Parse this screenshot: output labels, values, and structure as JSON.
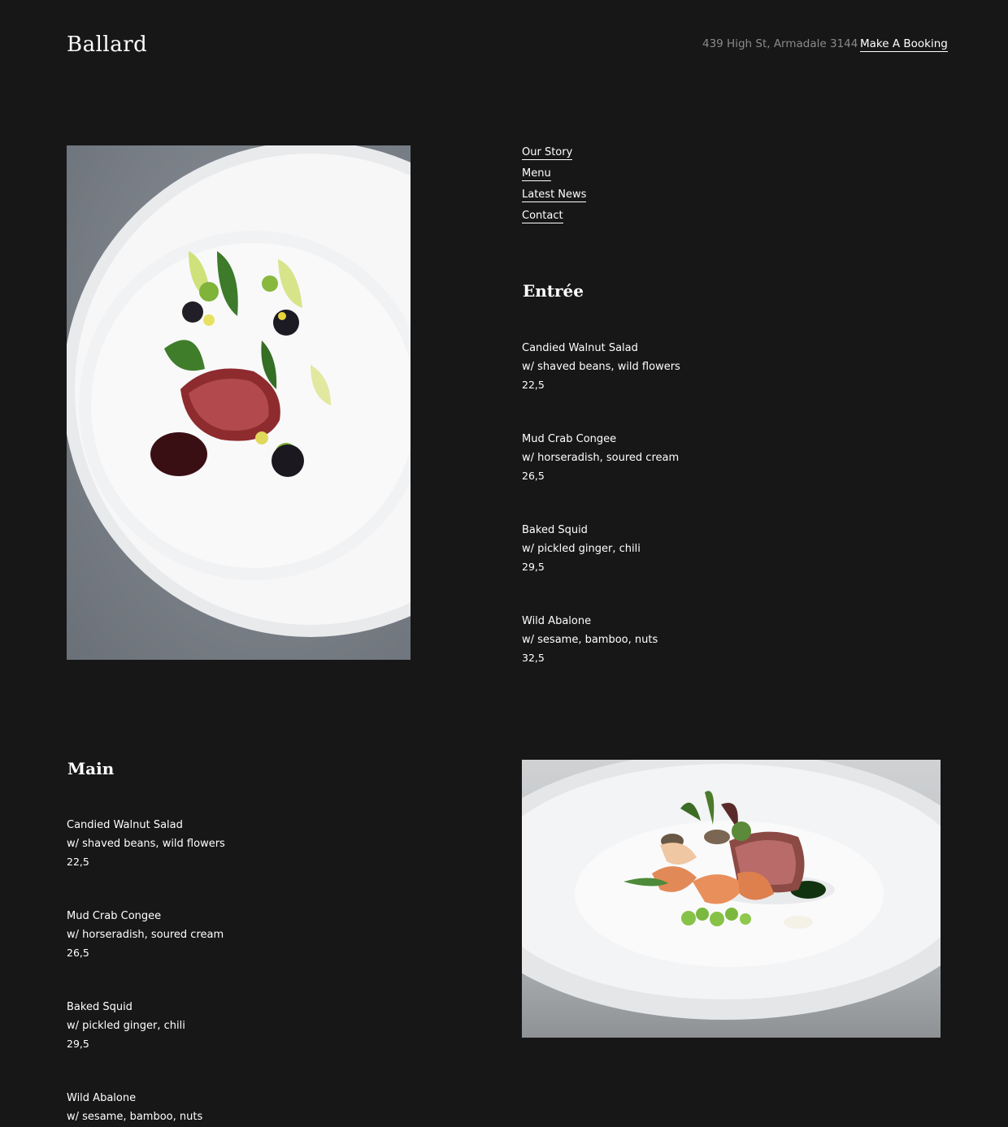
{
  "header": {
    "logo": "Ballard",
    "address": "439 High St, Armadale 3144",
    "booking_label": "Make A Booking"
  },
  "nav": {
    "items": [
      {
        "label": "Our Story"
      },
      {
        "label": "Menu"
      },
      {
        "label": "Latest News"
      },
      {
        "label": "Contact"
      }
    ]
  },
  "entree": {
    "title": "Entrée",
    "dishes": [
      {
        "name": "Candied Walnut Salad",
        "desc": "w/ shaved beans, wild flowers",
        "price": "22,5"
      },
      {
        "name": "Mud Crab Congee",
        "desc": "w/ horseradish, soured cream",
        "price": "26,5"
      },
      {
        "name": "Baked Squid",
        "desc": "w/ pickled ginger, chili",
        "price": "29,5"
      },
      {
        "name": "Wild Abalone",
        "desc": "w/ sesame, bamboo, nuts",
        "price": "32,5"
      }
    ]
  },
  "main": {
    "title": "Main",
    "dishes": [
      {
        "name": "Candied Walnut Salad",
        "desc": "w/ shaved beans, wild flowers",
        "price": "22,5"
      },
      {
        "name": "Mud Crab Congee",
        "desc": "w/ horseradish, soured cream",
        "price": "26,5"
      },
      {
        "name": "Baked Squid",
        "desc": "w/ pickled ginger, chili",
        "price": "29,5"
      },
      {
        "name": "Wild Abalone",
        "desc": "w/ sesame, bamboo, nuts",
        "price": ""
      }
    ]
  },
  "colors": {
    "background": "#171718",
    "text": "#ffffff",
    "muted": "#8a8a8a"
  }
}
